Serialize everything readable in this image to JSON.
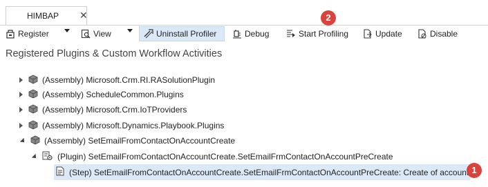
{
  "tab": {
    "title": "HIMBAP",
    "close_glyph": "✕"
  },
  "toolbar": {
    "register_label": "Register",
    "view_label": "View",
    "uninstall_label": "Uninstall Profiler",
    "debug_label": "Debug",
    "start_profiling_label": "Start Profiling",
    "update_label": "Update",
    "disable_label": "Disable"
  },
  "badges": {
    "start_profiling": "2",
    "step_row": "1"
  },
  "section": {
    "title": "Registered Plugins & Custom Workflow Activities"
  },
  "tree": {
    "assemblies": [
      {
        "label": "(Assembly) Microsoft.Crm.RI.RASolutionPlugin"
      },
      {
        "label": "(Assembly) ScheduleCommon.Plugins"
      },
      {
        "label": "(Assembly) Microsoft.Crm.IoTProviders"
      },
      {
        "label": "(Assembly) Microsoft.Dynamics.Playbook.Plugins"
      },
      {
        "label": "(Assembly) SetEmailFromContactOnAccountCreate"
      }
    ],
    "plugin": {
      "label": "(Plugin) SetEmailFromContactOnAccountCreate.SetEmailFrmContactOnAccountPreCreate"
    },
    "step": {
      "label": "(Step) SetEmailFromContactOnAccountCreate.SetEmailFrmContactOnAccountPreCreate: Create of account"
    }
  },
  "colors": {
    "accent_selection": "#dbe9f7",
    "badge": "#d9433b"
  }
}
